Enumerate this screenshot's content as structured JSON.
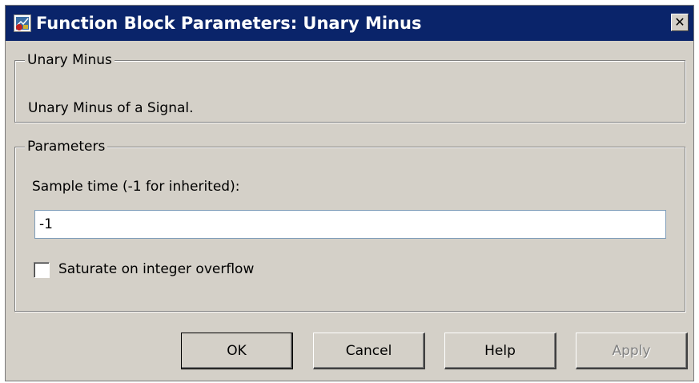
{
  "window": {
    "title": "Function Block Parameters: Unary Minus",
    "close_glyph": "✕",
    "app_icon": "simulink-block-icon",
    "title_bar_color": "#0a246a"
  },
  "description_group": {
    "legend": "Unary Minus",
    "text": "Unary Minus of a Signal."
  },
  "parameters_group": {
    "legend": "Parameters",
    "sample_time_label": "Sample time (-1 for inherited):",
    "sample_time_value": "-1",
    "saturate_label": "Saturate on integer overflow",
    "saturate_checked": false
  },
  "buttons": {
    "ok": "OK",
    "cancel": "Cancel",
    "help": "Help",
    "apply": "Apply"
  }
}
